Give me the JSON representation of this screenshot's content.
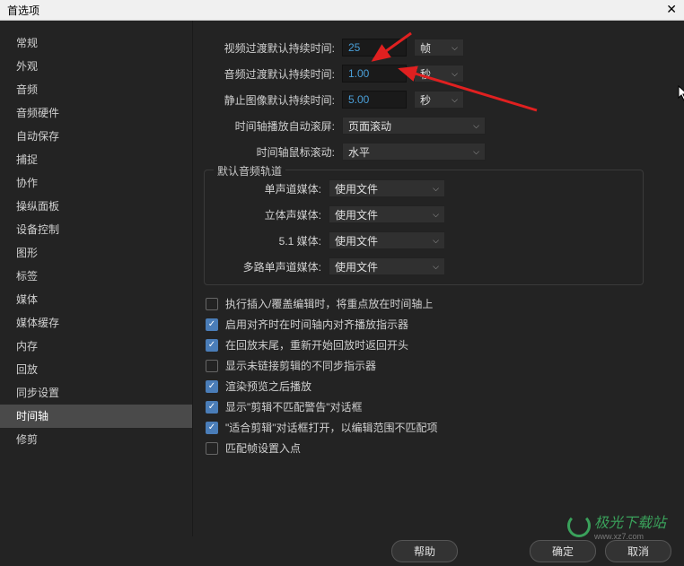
{
  "window": {
    "title": "首选项"
  },
  "sidebar": {
    "items": [
      {
        "label": "常规"
      },
      {
        "label": "外观"
      },
      {
        "label": "音频"
      },
      {
        "label": "音频硬件"
      },
      {
        "label": "自动保存"
      },
      {
        "label": "捕捉"
      },
      {
        "label": "协作"
      },
      {
        "label": "操纵面板"
      },
      {
        "label": "设备控制"
      },
      {
        "label": "图形"
      },
      {
        "label": "标签"
      },
      {
        "label": "媒体"
      },
      {
        "label": "媒体缓存"
      },
      {
        "label": "内存"
      },
      {
        "label": "回放"
      },
      {
        "label": "同步设置"
      },
      {
        "label": "时间轴"
      },
      {
        "label": "修剪"
      }
    ]
  },
  "settings": {
    "video_trans_label": "视频过渡默认持续时间:",
    "video_trans_value": "25",
    "video_trans_unit": "帧",
    "audio_trans_label": "音频过渡默认持续时间:",
    "audio_trans_value": "1.00",
    "audio_trans_unit": "秒",
    "still_label": "静止图像默认持续时间:",
    "still_value": "5.00",
    "still_unit": "秒",
    "scroll_label": "时间轴播放自动滚屏:",
    "scroll_value": "页面滚动",
    "mouse_label": "时间轴鼠标滚动:",
    "mouse_value": "水平"
  },
  "channels": {
    "legend": "默认音频轨道",
    "mono_label": "单声道媒体:",
    "mono_value": "使用文件",
    "stereo_label": "立体声媒体:",
    "stereo_value": "使用文件",
    "five1_label": "5.1 媒体:",
    "five1_value": "使用文件",
    "multi_label": "多路单声道媒体:",
    "multi_value": "使用文件"
  },
  "checks": [
    {
      "label": "执行插入/覆盖编辑时，将重点放在时间轴上",
      "checked": false
    },
    {
      "label": "启用对齐时在时间轴内对齐播放指示器",
      "checked": true
    },
    {
      "label": "在回放末尾，重新开始回放时返回开头",
      "checked": true
    },
    {
      "label": "显示未链接剪辑的不同步指示器",
      "checked": false
    },
    {
      "label": "渲染预览之后播放",
      "checked": true
    },
    {
      "label": "显示\"剪辑不匹配警告\"对话框",
      "checked": true
    },
    {
      "label": "\"适合剪辑\"对话框打开，以编辑范围不匹配项",
      "checked": true
    },
    {
      "label": "匹配帧设置入点",
      "checked": false
    }
  ],
  "footer": {
    "help": "帮助",
    "ok": "确定",
    "cancel": "取消"
  },
  "watermark": {
    "text": "极光下载站",
    "sub": "www.xz7.com"
  }
}
